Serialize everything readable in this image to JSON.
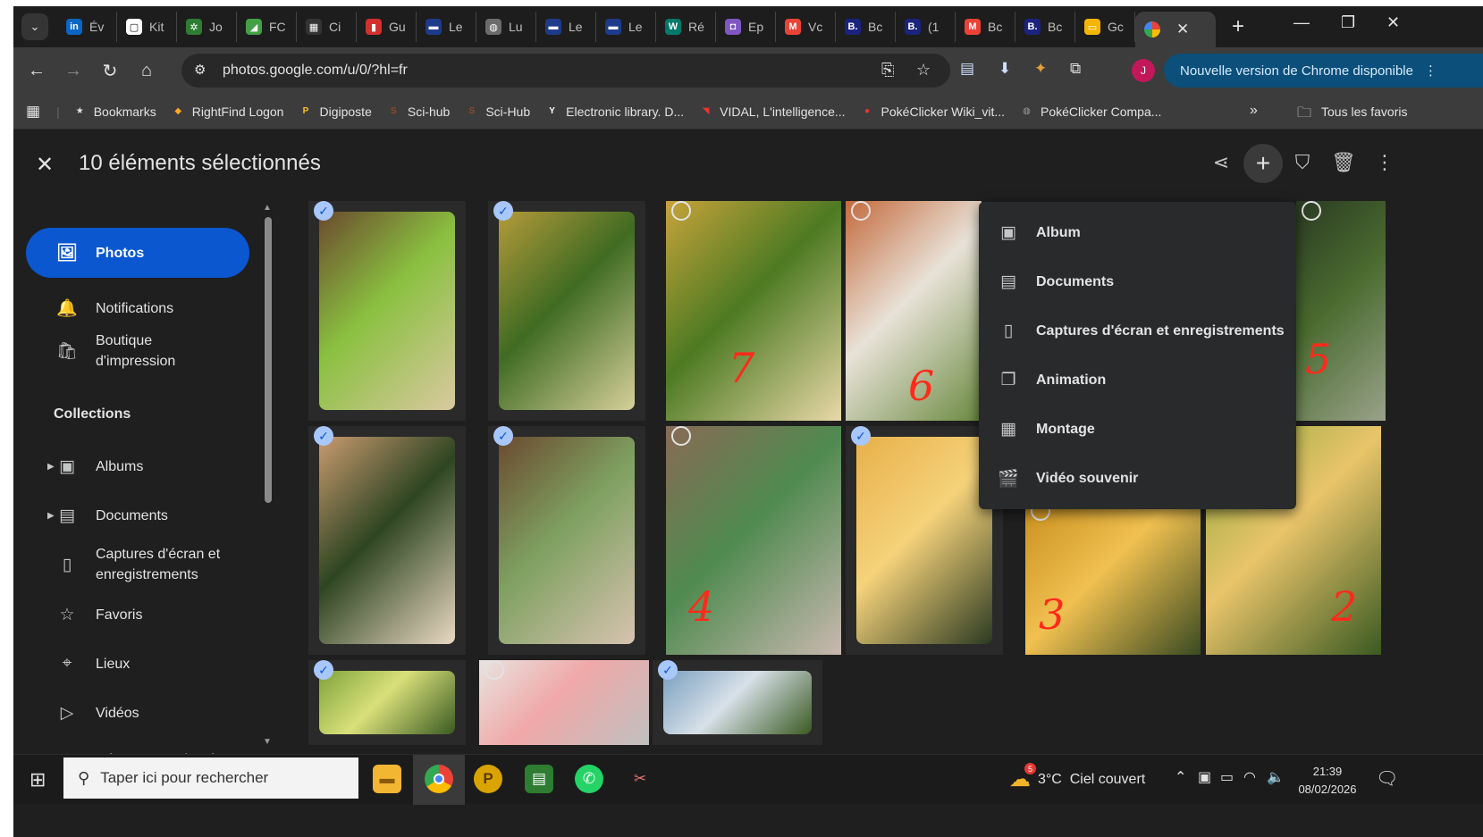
{
  "browser": {
    "tabs": [
      {
        "label": "Év",
        "icon_text": "in",
        "icon_color": "#0a66c2"
      },
      {
        "label": "Kit",
        "icon_text": "▢",
        "icon_color": "#ffffff"
      },
      {
        "label": "Jo",
        "icon_text": "✲",
        "icon_color": "#2e7d32"
      },
      {
        "label": "FC",
        "icon_text": "◢",
        "icon_color": "#43a047"
      },
      {
        "label": "Ci",
        "icon_text": "▦",
        "icon_color": "#333333"
      },
      {
        "label": "Gu",
        "icon_text": "▮",
        "icon_color": "#d32f2f"
      },
      {
        "label": "Le",
        "icon_text": "▬",
        "icon_color": "#1e3a8a"
      },
      {
        "label": "Lu",
        "icon_text": "◍",
        "icon_color": "#6b6b6b"
      },
      {
        "label": "Le",
        "icon_text": "▬",
        "icon_color": "#1e3a8a"
      },
      {
        "label": "Le",
        "icon_text": "▬",
        "icon_color": "#1e3a8a"
      },
      {
        "label": "Ré",
        "icon_text": "W",
        "icon_color": "#00796b"
      },
      {
        "label": "Ep",
        "icon_text": "◘",
        "icon_color": "#7e57c2"
      },
      {
        "label": "Vc",
        "icon_text": "M",
        "icon_color": "#ea4335"
      },
      {
        "label": "Bc",
        "icon_text": "B.",
        "icon_color": "#1a237e"
      },
      {
        "label": "(1",
        "icon_text": "B.",
        "icon_color": "#1a237e"
      },
      {
        "label": "Bc",
        "icon_text": "M",
        "icon_color": "#ea4335"
      },
      {
        "label": "Bc",
        "icon_text": "B.",
        "icon_color": "#1a237e"
      },
      {
        "label": "Gc",
        "icon_text": "▭",
        "icon_color": "#f4b400"
      }
    ],
    "active_tab_icon": "photos-pinwheel-icon",
    "url": "photos.google.com/u/0/?hl=fr",
    "update_text": "Nouvelle version de Chrome disponible",
    "avatar_letter": "J",
    "bookmarks": [
      {
        "label": "Bookmarks",
        "icon": "★",
        "icon_color": "#e3e3e3"
      },
      {
        "label": "RightFind Logon",
        "icon": "◆",
        "icon_color": "#f9a825"
      },
      {
        "label": "Digiposte",
        "icon": "P",
        "icon_color": "#fbc02d"
      },
      {
        "label": "Sci-hub",
        "icon": "S",
        "icon_color": "#8d4b2a"
      },
      {
        "label": "Sci-Hub",
        "icon": "S",
        "icon_color": "#8d4b2a"
      },
      {
        "label": "Electronic library. D...",
        "icon": "Y",
        "icon_color": "#ffffff"
      },
      {
        "label": "VIDAL, L'intelligence...",
        "icon": "◥",
        "icon_color": "#e53935"
      },
      {
        "label": "PokéClicker Wiki_vit...",
        "icon": "●",
        "icon_color": "#e53935"
      },
      {
        "label": "PokéClicker Compa...",
        "icon": "◍",
        "icon_color": "#9e9e9e"
      }
    ],
    "bookmarks_more": "»",
    "all_bookmarks": "Tous les favoris"
  },
  "app": {
    "selection_title": "10 éléments sélectionnés",
    "nav": [
      {
        "label": "Photos",
        "icon": "🖼",
        "active": true
      },
      {
        "label": "Notifications",
        "icon": "🔔",
        "active": false
      },
      {
        "label": "Boutique\nd'impression",
        "icon": "🛍",
        "active": false
      }
    ],
    "collections_label": "Collections",
    "collections": [
      {
        "label": "Albums",
        "icon": "▣",
        "caret": true
      },
      {
        "label": "Documents",
        "icon": "▤",
        "caret": true
      },
      {
        "label": "Captures d'écran et\nenregistrements",
        "icon": "▯",
        "caret": false
      },
      {
        "label": "Favoris",
        "icon": "☆",
        "caret": false
      },
      {
        "label": "Lieux",
        "icon": "⌖",
        "caret": false
      },
      {
        "label": "Vidéos",
        "icon": "▷",
        "caret": false
      },
      {
        "label": "Récemment ajoutées",
        "icon": "◷",
        "caret": false
      }
    ],
    "menu": [
      {
        "label": "Album",
        "icon": "▣"
      },
      {
        "label": "Documents",
        "icon": "▤"
      },
      {
        "label": "Captures d'écran et enregistrements",
        "icon": "▯"
      },
      {
        "label": "Animation",
        "icon": "❐"
      },
      {
        "label": "Montage",
        "icon": "▦"
      },
      {
        "label": "Vidéo souvenir",
        "icon": "🎬"
      }
    ],
    "photo_marks": [
      "7",
      "6",
      "5",
      "4",
      "3",
      "2"
    ]
  },
  "taskbar": {
    "search_placeholder": "Taper ici pour rechercher",
    "weather_badge": "5",
    "weather": "3°C  Ciel couvert",
    "time": "21:39",
    "date": "08/02/2026"
  }
}
